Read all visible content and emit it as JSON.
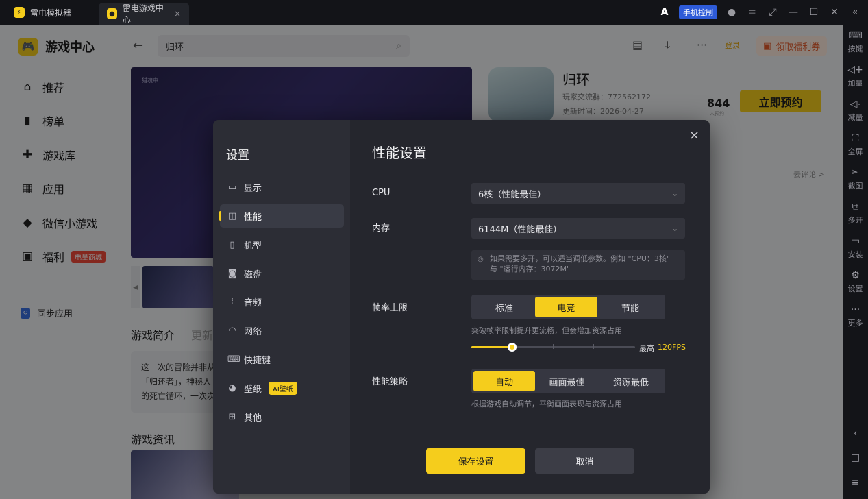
{
  "titlebar": {
    "tab1": "雷电模拟器",
    "tab2": "雷电游戏中心",
    "tab2_close": "×",
    "ai_label": "A",
    "phone_control": "手机控制"
  },
  "app": {
    "brand": "游戏中心",
    "nav": [
      {
        "label": "推荐",
        "icon": "home-icon"
      },
      {
        "label": "榜单",
        "icon": "chart-icon"
      },
      {
        "label": "游戏库",
        "icon": "gamepad-icon"
      },
      {
        "label": "应用",
        "icon": "apps-icon"
      },
      {
        "label": "微信小游戏",
        "icon": "mini-game-icon"
      },
      {
        "label": "福利",
        "icon": "gift-icon",
        "badge": "电量商城"
      }
    ],
    "sync": "同步应用",
    "search_value": "归环",
    "login": "登录",
    "welfare": "领取福利券"
  },
  "game": {
    "title": "归环",
    "community": "玩家交流群：772562172",
    "updated": "更新时间：2026-04-27",
    "count": "844",
    "count_label": "人预约",
    "reserve": "立即预约",
    "comments": "去评论 >",
    "banner_tag": "猎魂中",
    "intro_tab": "游戏简介",
    "update_tab": "更新",
    "intro_lines": [
      "这一次的冒险并非从",
      "「归还者」，神秘人",
      "的死亡循环，一次次"
    ],
    "news_title": "游戏资讯"
  },
  "rightbar": [
    {
      "label": "按键",
      "icon": "keyboard-icon"
    },
    {
      "label": "加量",
      "icon": "volume-up-icon"
    },
    {
      "label": "减量",
      "icon": "volume-down-icon"
    },
    {
      "label": "全屏",
      "icon": "fullscreen-icon"
    },
    {
      "label": "截图",
      "icon": "scissors-icon"
    },
    {
      "label": "多开",
      "icon": "multi-instance-icon"
    },
    {
      "label": "安装",
      "icon": "apk-icon"
    },
    {
      "label": "设置",
      "icon": "settings-icon"
    },
    {
      "label": "更多",
      "icon": "more-icon"
    }
  ],
  "settings": {
    "side_title": "设置",
    "items": [
      {
        "label": "显示",
        "icon": "monitor-icon"
      },
      {
        "label": "性能",
        "icon": "performance-icon"
      },
      {
        "label": "机型",
        "icon": "phone-icon"
      },
      {
        "label": "磁盘",
        "icon": "disk-icon"
      },
      {
        "label": "音频",
        "icon": "audio-icon"
      },
      {
        "label": "网络",
        "icon": "wifi-icon"
      },
      {
        "label": "快捷键",
        "icon": "keyboard-icon"
      },
      {
        "label": "壁纸",
        "icon": "palette-icon",
        "badge": "AI壁纸"
      },
      {
        "label": "其他",
        "icon": "grid-icon"
      }
    ],
    "active_index": 1,
    "title": "性能设置",
    "cpu_label": "CPU",
    "cpu_value": "6核（性能最佳）",
    "memory_label": "内存",
    "memory_value": "6144M（性能最佳）",
    "tip": "如果需要多开，可以适当调低参数。例如 \"CPU：3核\" 与 \"运行内存：3072M\"",
    "fps_label": "帧率上限",
    "fps_options": [
      "标准",
      "电竞",
      "节能"
    ],
    "fps_selected": "电竞",
    "fps_hint": "突破帧率限制提升更流畅，但会增加资源占用",
    "fps_slider_fraction": 0.25,
    "fps_max_label": "最高",
    "fps_max_value": "120FPS",
    "strategy_label": "性能策略",
    "strategy_options": [
      "自动",
      "画面最佳",
      "资源最低"
    ],
    "strategy_selected": "自动",
    "strategy_hint": "根据游戏自动调节，平衡画面表现与资源占用",
    "save": "保存设置",
    "cancel": "取消",
    "close": "×"
  },
  "colors": {
    "accent": "#f5cd1c",
    "dialog_bg": "#25262d",
    "sidebar_bg": "#2c2d35"
  }
}
